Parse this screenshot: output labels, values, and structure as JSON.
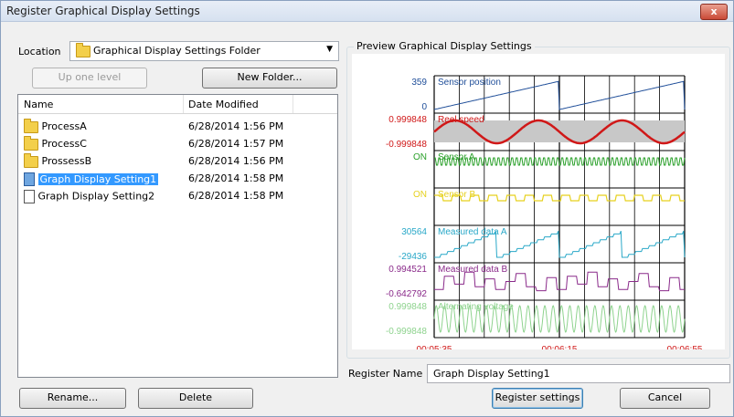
{
  "window": {
    "title": "Register Graphical Display Settings",
    "close_glyph": "x"
  },
  "location": {
    "label": "Location",
    "selected": "Graphical Display Settings Folder"
  },
  "buttons": {
    "up_one_level": "Up one level",
    "new_folder": "New Folder...",
    "rename": "Rename...",
    "delete": "Delete",
    "register_settings": "Register settings",
    "cancel": "Cancel"
  },
  "file_list": {
    "columns": [
      "Name",
      "Date Modified"
    ],
    "rows": [
      {
        "name": "ProcessA",
        "date": "6/28/2014 1:56 PM",
        "type": "folder"
      },
      {
        "name": "ProcessC",
        "date": "6/28/2014 1:57 PM",
        "type": "folder"
      },
      {
        "name": "ProssessB",
        "date": "6/28/2014 1:56 PM",
        "type": "folder"
      },
      {
        "name": "Graph Display Setting1",
        "date": "6/28/2014 1:58 PM",
        "type": "file",
        "selected": true
      },
      {
        "name": "Graph Display Setting2",
        "date": "6/28/2014 1:58 PM",
        "type": "file"
      }
    ]
  },
  "preview": {
    "label": "Preview Graphical Display Settings",
    "channels": [
      {
        "name": "Sensor position",
        "max": "359",
        "min": "0",
        "color": "#1f4e99"
      },
      {
        "name": "Reel speed",
        "max": "0.999848",
        "min": "-0.999848",
        "color": "#d01818"
      },
      {
        "name": "Sensor A",
        "max": "ON",
        "min": "",
        "color": "#2aa02a"
      },
      {
        "name": "Sensor B",
        "max": "ON",
        "min": "",
        "color": "#e6d11e"
      },
      {
        "name": "Measured data A",
        "max": "30564",
        "min": "-29436",
        "color": "#29a8c8"
      },
      {
        "name": "Measured data B",
        "max": "0.994521",
        "min": "-0.642792",
        "color": "#8a2a8a"
      },
      {
        "name": "Alternating voltage",
        "max": "0.999848",
        "min": "-0.999848",
        "color": "#8ed38e"
      }
    ],
    "time_labels": [
      "00:05:35",
      "00:06:15",
      "00:06:55"
    ],
    "time_color": "#d01818"
  },
  "register_name": {
    "label": "Register Name",
    "value": "Graph Display Setting1"
  }
}
